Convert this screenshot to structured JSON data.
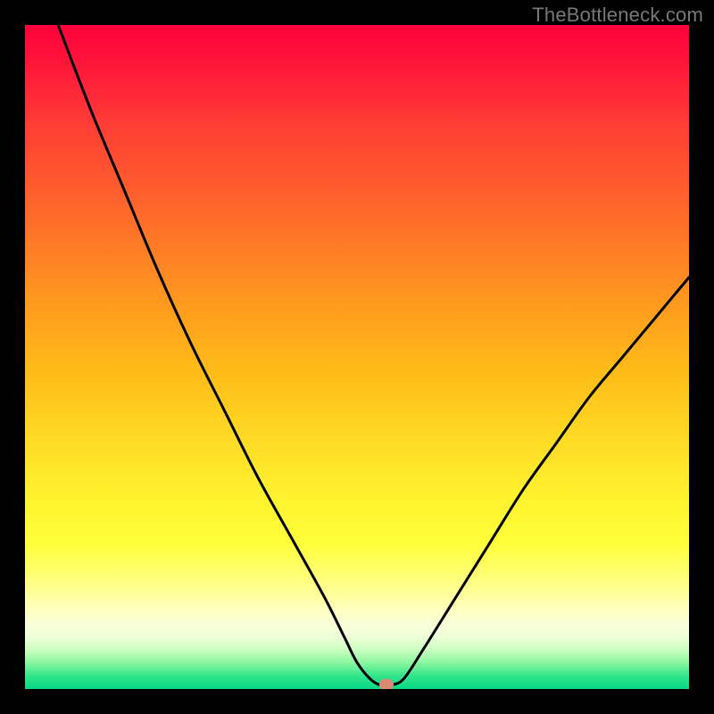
{
  "watermark": "TheBottleneck.com",
  "marker": {
    "x_frac": 0.545,
    "y_frac": 0.993
  },
  "chart_data": {
    "type": "line",
    "title": "",
    "xlabel": "",
    "ylabel": "",
    "xlim": [
      0,
      100
    ],
    "ylim": [
      0,
      100
    ],
    "series": [
      {
        "name": "bottleneck-curve",
        "x": [
          5,
          10,
          15,
          20,
          25,
          30,
          35,
          40,
          45,
          48,
          50,
          52,
          53.5,
          55,
          57,
          60,
          65,
          70,
          75,
          80,
          85,
          90,
          95,
          100
        ],
        "values": [
          100,
          87,
          75,
          63,
          52,
          42,
          32,
          23,
          14,
          8,
          4,
          1.5,
          0.6,
          0.6,
          1.5,
          6,
          14,
          22,
          30,
          37,
          44,
          50,
          56,
          62
        ]
      }
    ],
    "marker_point": {
      "x": 54.5,
      "y": 0.6,
      "color": "#d88a74"
    },
    "background_gradient": {
      "top": "#ff003b",
      "mid": "#ffff3a",
      "bottom": "#08d884"
    }
  }
}
